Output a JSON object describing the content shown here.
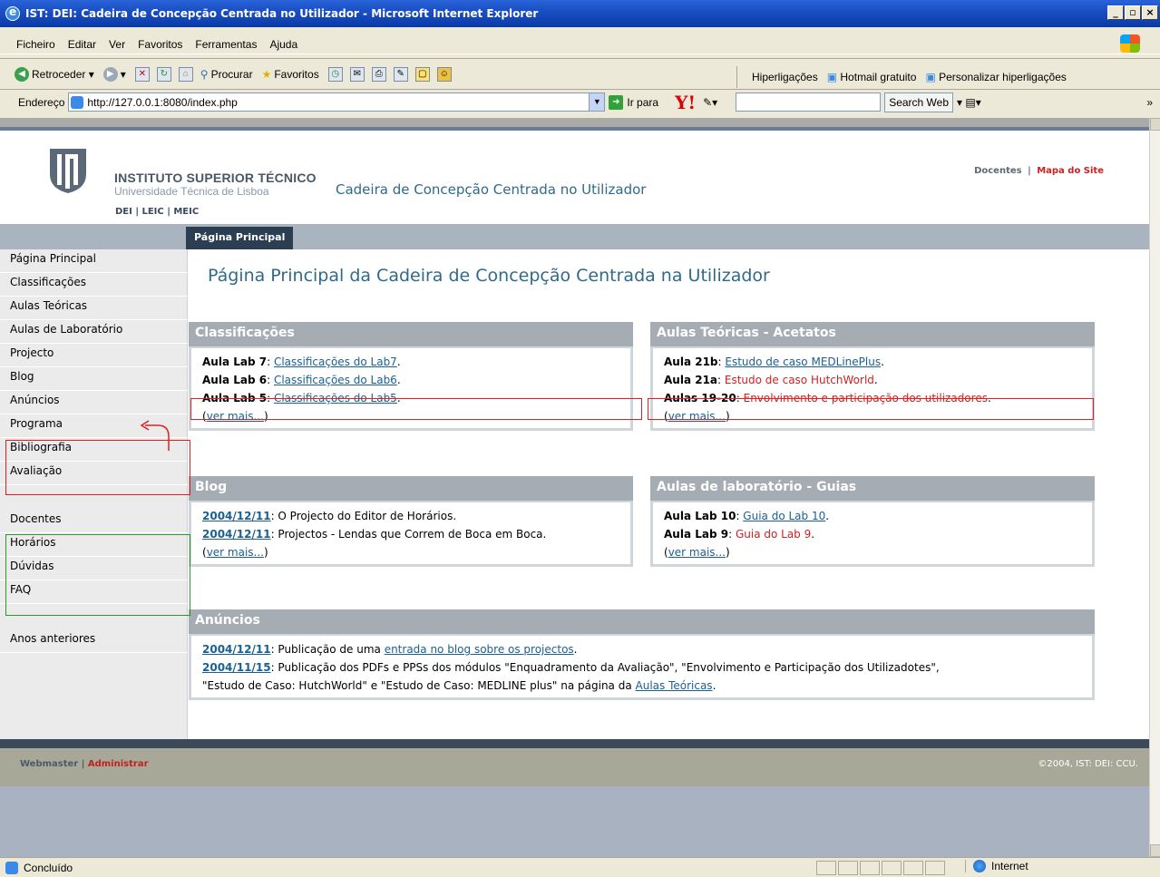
{
  "window": {
    "title": "IST: DEI: Cadeira de Concepção Centrada no Utilizador - Microsoft Internet Explorer"
  },
  "menu": [
    "Ficheiro",
    "Editar",
    "Ver",
    "Favoritos",
    "Ferramentas",
    "Ajuda"
  ],
  "toolbar": {
    "back": "Retroceder",
    "search": "Procurar",
    "favorites": "Favoritos",
    "links_label": "Hiperligações",
    "links": [
      "Hotmail gratuito",
      "Personalizar hiperligações"
    ]
  },
  "address": {
    "label": "Endereço",
    "url": "http://127.0.0.1:8080/index.php",
    "go": "Ir para",
    "search_web": "Search Web"
  },
  "site": {
    "inst_name": "INSTITUTO SUPERIOR TÉCNICO",
    "univ": "Universidade Técnica de Lisboa",
    "dept_links": "DEI | LEIC | MEIC",
    "course": "Cadeira de Concepção Centrada no Utilizador",
    "top_docentes": "Docentes",
    "top_sep": "|",
    "top_map": "Mapa do Site",
    "tab": "Página Principal"
  },
  "sidebar": {
    "items": [
      "Página Principal",
      "Classificações",
      "Aulas Teóricas",
      "Aulas de Laboratório",
      "Projecto",
      "Blog",
      "Anúncios",
      "Programa",
      "Bibliografia",
      "Avaliação"
    ],
    "items2": [
      "Docentes",
      "Horários",
      "Dúvidas",
      "FAQ"
    ],
    "items3": [
      "Anos anteriores"
    ]
  },
  "main": {
    "title": "Página Principal da Cadeira de Concepção Centrada na Utilizador",
    "classificacoes": {
      "title": "Classificações",
      "rows": [
        {
          "label": "Aula Lab 7",
          "link": "Classificações do Lab7"
        },
        {
          "label": "Aula Lab 6",
          "link": "Classificações do Lab6"
        },
        {
          "label": "Aula Lab 5",
          "link": "Classificações do Lab5"
        }
      ],
      "more": "ver mais..."
    },
    "teoricas": {
      "title": "Aulas Teóricas - Acetatos",
      "rows": [
        {
          "label": "Aula 21b",
          "link": "Estudo de caso MEDLinePlus"
        },
        {
          "label": "Aula 21a",
          "link": "Estudo de caso HutchWorld"
        },
        {
          "label": "Aulas 19-20",
          "link": "Envolvimento e participação dos utilizadores"
        }
      ],
      "more": "ver mais..."
    },
    "blog": {
      "title": "Blog",
      "rows": [
        {
          "date": "2004/12/11",
          "text": "O Projecto do Editor de Horários."
        },
        {
          "date": "2004/12/11",
          "text": "Projectos - Lendas que Correm de Boca em Boca."
        }
      ],
      "more": "ver mais..."
    },
    "lab": {
      "title": "Aulas de laboratório - Guias",
      "rows": [
        {
          "label": "Aula Lab 10",
          "link": "Guia do Lab 10"
        },
        {
          "label": "Aula Lab 9",
          "link": "Guia do Lab 9"
        }
      ],
      "more": "ver mais..."
    },
    "anuncios": {
      "title": "Anúncios",
      "a1_date": "2004/12/11",
      "a1_pre": "Publicação de uma ",
      "a1_link": "entrada no blog sobre os projectos",
      "a2_date": "2004/11/15",
      "a2_text": "Publicação dos PDFs e PPSs dos módulos \"Enquadramento da Avaliação\", \"Envolvimento e Participação dos Utilizadotes\",",
      "a2_text2": "\"Estudo de Caso: HutchWorld\" e \"Estudo de Caso: MEDLINE plus\" na página da ",
      "a2_link": "Aulas Teóricas"
    }
  },
  "footer": {
    "webmaster": "Webmaster",
    "sep": "|",
    "admin": "Administrar",
    "copyright": "©2004, IST: DEI: CCU."
  },
  "status": {
    "text": "Concluído",
    "zone": "Internet"
  }
}
